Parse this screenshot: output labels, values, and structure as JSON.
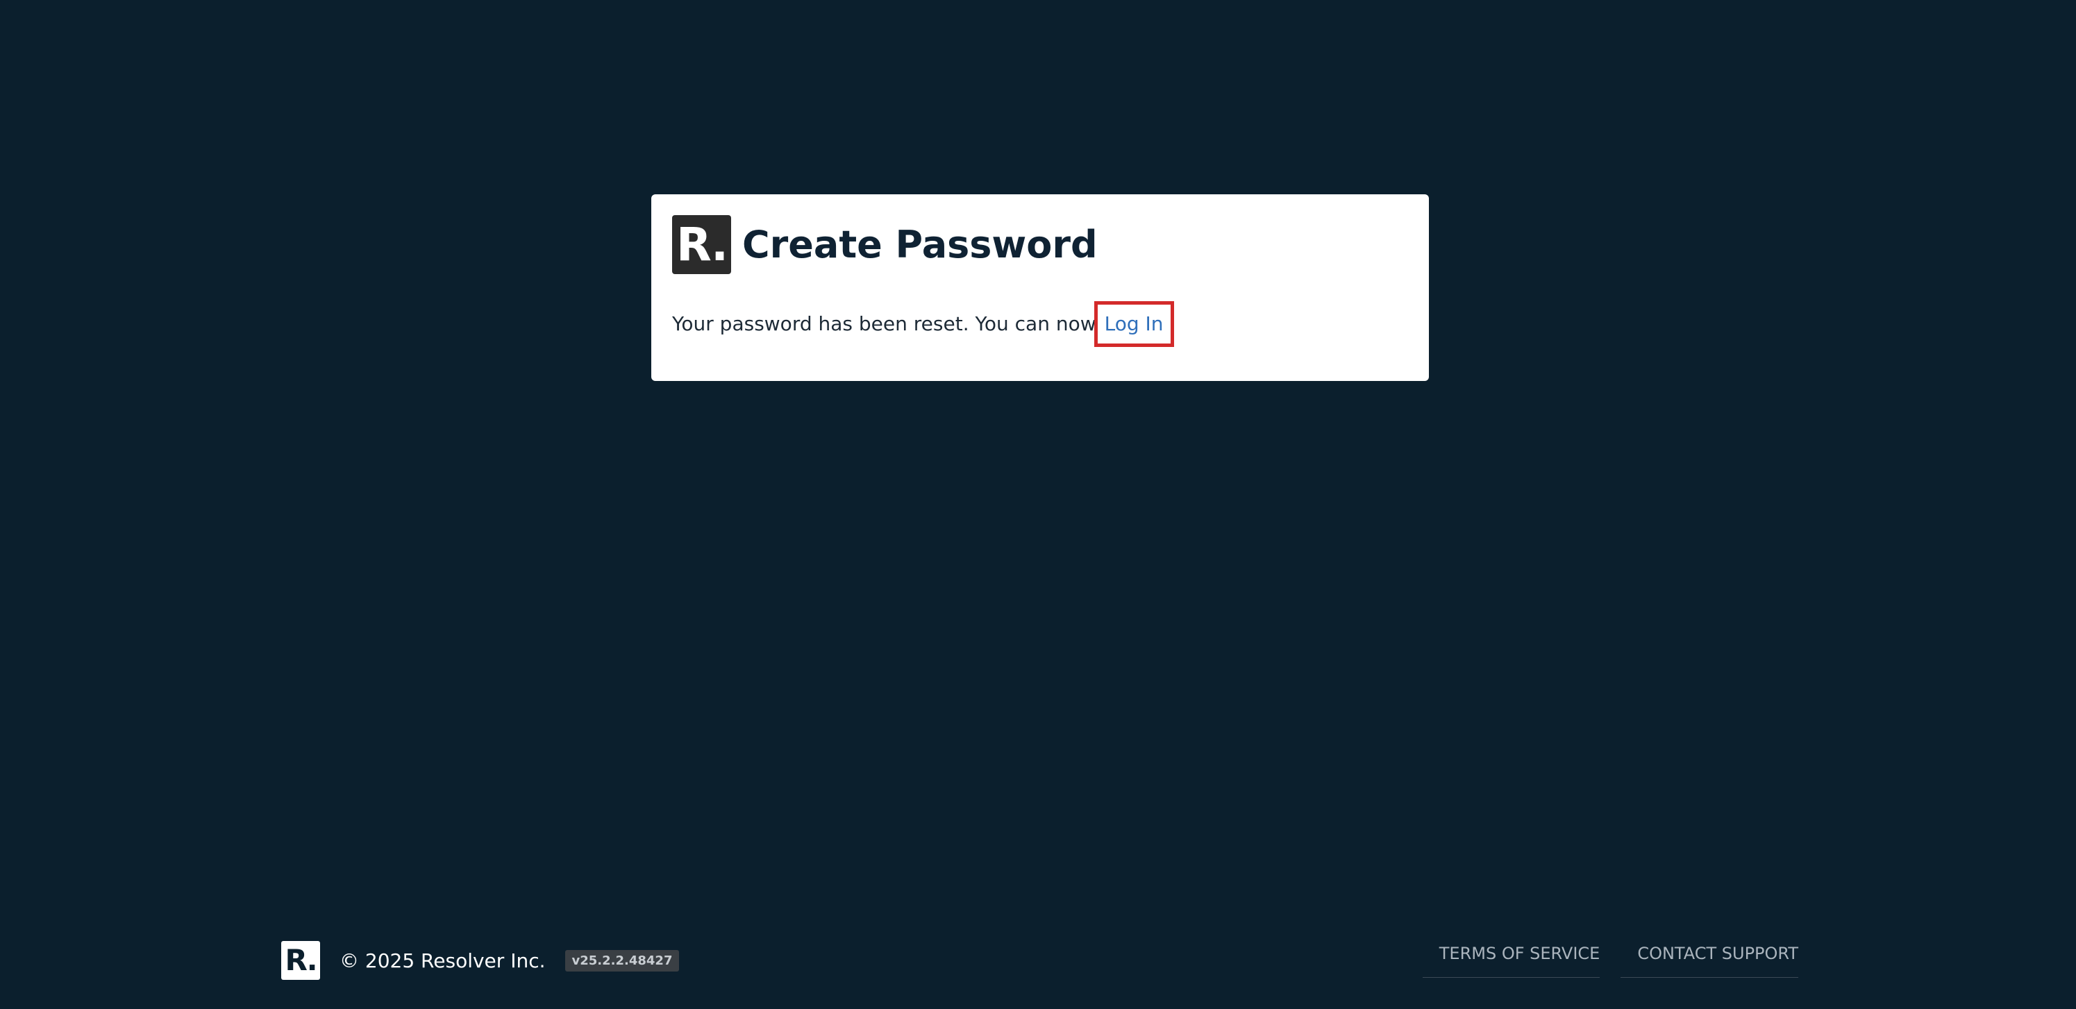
{
  "card": {
    "logo_text": "R.",
    "title": "Create Password",
    "message": "Your password has been reset. You can now",
    "login_link": "Log In"
  },
  "footer": {
    "logo_text": "R.",
    "copyright": "© 2025 Resolver Inc.",
    "version": "v25.2.2.48427",
    "links": {
      "terms": "TERMS OF SERVICE",
      "support": "CONTACT SUPPORT"
    }
  }
}
